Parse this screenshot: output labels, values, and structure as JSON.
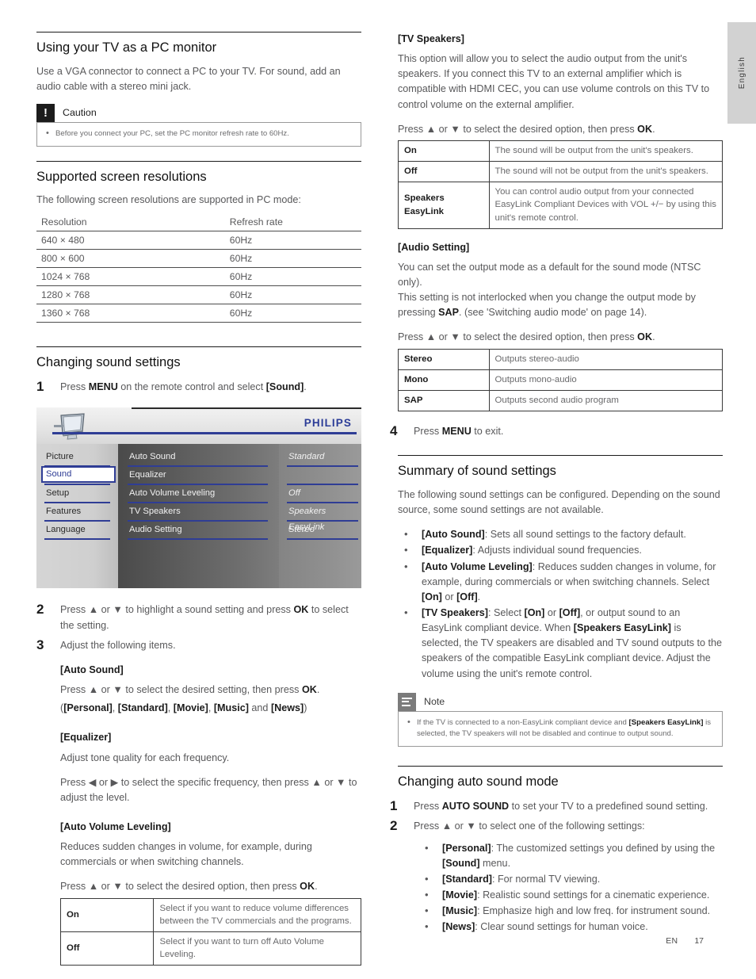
{
  "page": {
    "language_tab": "English",
    "footer_locale": "EN",
    "footer_page": "17"
  },
  "left": {
    "s1": {
      "heading": "Using your TV as a PC monitor",
      "intro": "Use a VGA connector to connect a PC to your TV. For sound, add an audio cable with a stereo mini jack.",
      "caution": {
        "icon": "exclamation-icon",
        "title": "Caution",
        "bullet": "Before you connect your PC, set the PC monitor refresh rate to 60Hz."
      }
    },
    "s2": {
      "heading": "Supported screen resolutions",
      "intro": "The following screen resolutions are supported in PC mode:",
      "table": {
        "headers": [
          "Resolution",
          "Refresh rate"
        ],
        "rows": [
          [
            "640 × 480",
            "60Hz"
          ],
          [
            "800 × 600",
            "60Hz"
          ],
          [
            "1024 × 768",
            "60Hz"
          ],
          [
            "1280 × 768",
            "60Hz"
          ],
          [
            "1360 × 768",
            "60Hz"
          ]
        ]
      }
    },
    "s3": {
      "heading": "Changing sound settings",
      "step1_num": "1",
      "step1_pre": "Press ",
      "step1_menu": "MENU",
      "step1_mid": " on the remote control and select ",
      "step1_sound": "[Sound]",
      "step1_end": ".",
      "step2_num": "2",
      "step2_a": "Press ",
      "step2_up": "▲",
      "step2_or": " or ",
      "step2_dn": "▼",
      "step2_b": " to highlight a sound setting and press ",
      "step2_ok": "OK",
      "step2_c": " to select the setting.",
      "step3_num": "3",
      "step3_text": "Adjust the following items.",
      "sub1": {
        "title": "[Auto Sound]",
        "line1_a": "Press ",
        "line1_b": " or ",
        "line1_c": " to select the desired setting, then press ",
        "line1_ok": "OK",
        "line1_d": ".",
        "line2_open": "(",
        "line2_items": [
          "[Personal]",
          "[Standard]",
          "[Movie]",
          "[Music]"
        ],
        "line2_and": " and ",
        "line2_last": "[News]",
        "line2_close": ")"
      },
      "sub2": {
        "title": "[Equalizer]",
        "line1": "Adjust tone quality for each frequency.",
        "line2_a": "Press ",
        "line2_left": "◀",
        "line2_or": " or ",
        "line2_right": "▶",
        "line2_b": " to select the specific frequency, then press ",
        "line2_up": "▲",
        "line2_dn": "▼",
        "line2_c": " to adjust the level."
      },
      "sub3": {
        "title": "[Auto Volume Leveling]",
        "line1": "Reduces sudden changes in volume, for example, during commercials or when switching channels.",
        "line2_a": "Press ",
        "line2_b": " or ",
        "line2_c": " to select the desired option, then press ",
        "line2_ok": "OK",
        "line2_d": ".",
        "table": [
          [
            "On",
            "Select if you want to reduce volume differences between the TV commercials and the programs."
          ],
          [
            "Off",
            "Select if you want to turn off Auto Volume Leveling."
          ]
        ]
      }
    },
    "osd": {
      "brand": "PHILIPS",
      "icon": "tv-monitor-icon",
      "menu_left": [
        "Picture",
        "Sound",
        "Setup",
        "Features",
        "Language"
      ],
      "selected_left": "Sound",
      "menu_mid": [
        "Auto Sound",
        "Equalizer",
        "Auto Volume Leveling",
        "TV Speakers",
        "Audio Setting"
      ],
      "menu_right": [
        "Standard",
        "",
        "Off",
        "Speakers EasyLink",
        "Stereo"
      ],
      "accent_color": "#2f3d95"
    }
  },
  "right": {
    "s1": {
      "title": "[TV Speakers]",
      "para": "This option will allow you to select the audio output from the unit's speakers. If you connect this TV to an external amplifier which is compatible with HDMI CEC, you can use volume controls on this TV to control volume on the external amplifier.",
      "press_a": "Press ",
      "press_or": " or ",
      "press_b": " to select the desired option, then press ",
      "press_ok": "OK",
      "press_end": ".",
      "table": [
        [
          "On",
          "The sound will be output from the unit's speakers."
        ],
        [
          "Off",
          "The sound will not be output from the unit's speakers."
        ],
        [
          "Speakers EasyLink",
          "You can control audio output from your connected EasyLink Compliant Devices with VOL +/− by using this unit's remote control."
        ]
      ],
      "table_row3_bold": "VOL +/−"
    },
    "s2": {
      "title": "[Audio Setting]",
      "para1": "You can set the output mode as a default for the sound mode (NTSC only).",
      "para2_a": "This setting is not interlocked when you change the output mode by pressing ",
      "para2_sap": "SAP",
      "para2_b": ". (see 'Switching audio mode' on page 14).",
      "press_a": "Press ",
      "press_or": " or ",
      "press_b": " to select the desired option, then press ",
      "press_ok": "OK",
      "press_end": ".",
      "table": [
        [
          "Stereo",
          "Outputs stereo-audio"
        ],
        [
          "Mono",
          "Outputs mono-audio"
        ],
        [
          "SAP",
          "Outputs second audio program"
        ]
      ],
      "step4_num": "4",
      "step4_a": "Press ",
      "step4_menu": "MENU",
      "step4_b": " to exit."
    },
    "s3": {
      "heading": "Summary of sound settings",
      "intro": "The following sound settings can be configured. Depending on the sound source, some sound settings are not available.",
      "bullets": [
        {
          "key": "[Auto Sound]",
          "text": ": Sets all sound settings to the factory default."
        },
        {
          "key": "[Equalizer]",
          "text": ": Adjusts individual sound frequencies."
        },
        {
          "key": "[Auto Volume Leveling]",
          "text": ": Reduces sudden changes in volume, for example, during commercials or when switching channels. Select ",
          "k2": "[On]",
          "mid": " or ",
          "k3": "[Off]",
          "tail": "."
        },
        {
          "key": "[TV Speakers]",
          "text": ": Select ",
          "k2": "[On]",
          "mid": " or ",
          "k3": "[Off]",
          "tail": ", or output sound to an EasyLink compliant device. When ",
          "k4": "[Speakers EasyLink]",
          "tail2": " is selected, the TV speakers are disabled and TV sound outputs to the speakers of the compatible EasyLink compliant device. Adjust the volume using the unit's remote control."
        }
      ],
      "note": {
        "icon": "note-lines-icon",
        "title": "Note",
        "bullet_a": "If the TV is connected to a non-EasyLink compliant device and ",
        "bullet_key": "[Speakers EasyLink]",
        "bullet_b": " is selected, the TV speakers will not be disabled and continue to output sound."
      }
    },
    "s4": {
      "heading": "Changing auto sound mode",
      "step1_num": "1",
      "step1_a": "Press ",
      "step1_key": "AUTO SOUND",
      "step1_b": " to set your TV to a predefined sound setting.",
      "step2_num": "2",
      "step2_a": "Press ",
      "step2_or": " or ",
      "step2_b": " to select one of the following settings:",
      "bullets": [
        {
          "key": "[Personal]",
          "text": ": The customized settings you defined by using the ",
          "k2": "[Sound]",
          "tail": " menu."
        },
        {
          "key": "[Standard]",
          "text": ": For normal TV viewing."
        },
        {
          "key": "[Movie]",
          "text": ": Realistic sound settings for a cinematic experience."
        },
        {
          "key": "[Music]",
          "text": ": Emphasize high and low freq. for instrument sound."
        },
        {
          "key": "[News]",
          "text": ": Clear sound settings for human voice."
        }
      ]
    }
  },
  "glyphs": {
    "up": "▲",
    "down": "▼",
    "left": "◀",
    "right": "▶"
  }
}
